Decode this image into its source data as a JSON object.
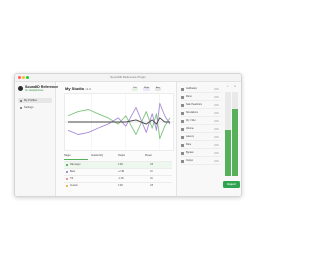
{
  "window": {
    "title": "SoundID Reference Plugin",
    "controls": {
      "close_color": "#ff5f57",
      "minimize_color": "#febc2e",
      "maximize_color": "#28c840"
    }
  },
  "sidebar": {
    "logo_title": "SoundID Reference",
    "logo_sub": "for Headphones",
    "items": [
      {
        "label": "My Profiles",
        "icon": "headphones-icon"
      },
      {
        "label": "Settings",
        "icon": "gear-icon"
      }
    ]
  },
  "main": {
    "profile_title": "My Studio",
    "profile_suffix": "v1.0",
    "legend": [
      {
        "label": "Left",
        "color": "#7ec37f"
      },
      {
        "label": "Right",
        "color": "#a78bd7"
      },
      {
        "label": "Avg",
        "color": "#444444"
      }
    ],
    "tabs": [
      "Target",
      "Custom EQ",
      "Output",
      "Preset"
    ],
    "rows": [
      {
        "name": "Flat target",
        "color": "#57b05a",
        "value1": "0 dB",
        "value2": "Off"
      },
      {
        "name": "Bass",
        "color": "#a78bd7",
        "value1": "+2 dB",
        "value2": "On"
      },
      {
        "name": "Tilt",
        "color": "#ef8c8c",
        "value1": "-1 dB",
        "value2": "On"
      },
      {
        "name": "Custom",
        "color": "#f2b248",
        "value1": "0 dB",
        "value2": "Off"
      }
    ]
  },
  "chart_data": {
    "type": "line",
    "title": "",
    "xlabel": "",
    "ylabel": "",
    "series": [
      {
        "name": "Left",
        "color": "#7ec37f",
        "x": [
          20,
          40,
          80,
          150,
          300,
          600,
          1000,
          2000,
          4000,
          6000,
          8000,
          10000,
          14000,
          20000
        ],
        "values": [
          3,
          5,
          6,
          4,
          2,
          -1,
          3,
          -6,
          5,
          -3,
          4,
          -8,
          -2,
          2
        ]
      },
      {
        "name": "Right",
        "color": "#a78bd7",
        "x": [
          20,
          40,
          80,
          150,
          300,
          600,
          1000,
          2000,
          4000,
          6000,
          8000,
          10000,
          14000,
          20000
        ],
        "values": [
          -4,
          -6,
          -5,
          -3,
          -1,
          2,
          -2,
          7,
          -5,
          4,
          -4,
          9,
          3,
          -1
        ]
      },
      {
        "name": "Avg",
        "color": "#444444",
        "x": [
          20,
          40,
          80,
          150,
          300,
          600,
          1000,
          2000,
          4000,
          6000,
          8000,
          10000,
          14000,
          20000
        ],
        "values": [
          0,
          0,
          0,
          0,
          0,
          0,
          0,
          1,
          -1,
          1,
          -1,
          2,
          0,
          0
        ]
      }
    ],
    "ylim": [
      -12,
      12
    ],
    "xscale": "log",
    "grid": true
  },
  "right_panel": {
    "categories": [
      {
        "label": "Calibration",
        "icon": "wave-icon"
      },
      {
        "label": "Mono",
        "icon": "speaker-icon"
      },
      {
        "label": "Safe Headroom",
        "icon": "shield-icon"
      },
      {
        "label": "Simulations",
        "icon": "headphones-icon"
      },
      {
        "label": "Dry / Wet",
        "icon": "mix-icon"
      },
      {
        "label": "Volume",
        "icon": "volume-icon"
      },
      {
        "label": "Latency",
        "icon": "clock-icon"
      },
      {
        "label": "Mute",
        "icon": "mute-icon"
      },
      {
        "label": "Bypass",
        "icon": "power-icon"
      },
      {
        "label": "Output",
        "icon": "output-icon"
      }
    ],
    "meters": {
      "labels": [
        "L",
        "R"
      ],
      "levels": [
        0.55,
        0.8
      ],
      "color": "#57b05a"
    },
    "export_label": "Export"
  }
}
